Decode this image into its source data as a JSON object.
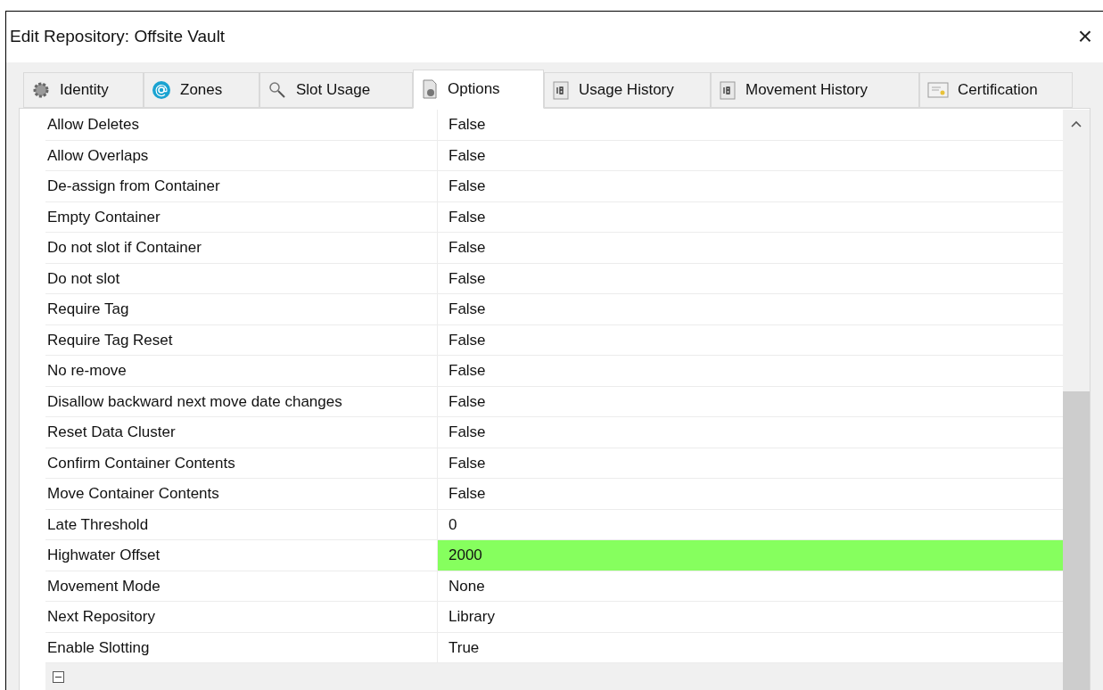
{
  "window": {
    "title": "Edit Repository: Offsite Vault",
    "close": "×"
  },
  "tabs": [
    {
      "label": "Identity",
      "kind": "gear",
      "selected": false
    },
    {
      "label": "Zones",
      "kind": "at",
      "selected": false
    },
    {
      "label": "Slot Usage",
      "kind": "search",
      "selected": false
    },
    {
      "label": "Options",
      "kind": "document",
      "selected": true
    },
    {
      "label": "Usage History",
      "kind": "calendar",
      "selected": false
    },
    {
      "label": "Movement History",
      "kind": "calendar",
      "selected": false
    },
    {
      "label": "Certification",
      "kind": "certificate",
      "selected": false
    }
  ],
  "properties": [
    {
      "name": "Allow Deletes",
      "value": "False",
      "highlighted": false
    },
    {
      "name": "Allow Overlaps",
      "value": "False",
      "highlighted": false
    },
    {
      "name": "De-assign from Container",
      "value": "False",
      "highlighted": false
    },
    {
      "name": "Empty Container",
      "value": "False",
      "highlighted": false
    },
    {
      "name": "Do not slot if Container",
      "value": "False",
      "highlighted": false
    },
    {
      "name": "Do not slot",
      "value": "False",
      "highlighted": false
    },
    {
      "name": "Require Tag",
      "value": "False",
      "highlighted": false
    },
    {
      "name": "Require Tag Reset",
      "value": "False",
      "highlighted": false
    },
    {
      "name": "No re-move",
      "value": "False",
      "highlighted": false
    },
    {
      "name": "Disallow backward next move date changes",
      "value": "False",
      "highlighted": false
    },
    {
      "name": "Reset Data Cluster",
      "value": "False",
      "highlighted": false
    },
    {
      "name": "Confirm Container Contents",
      "value": "False",
      "highlighted": false
    },
    {
      "name": "Move Container Contents",
      "value": "False",
      "highlighted": false
    },
    {
      "name": "Late Threshold",
      "value": "0",
      "highlighted": false
    },
    {
      "name": "Highwater Offset",
      "value": "2000",
      "highlighted": true
    },
    {
      "name": "Movement Mode",
      "value": "None",
      "highlighted": false
    },
    {
      "name": "Next Repository",
      "value": "Library",
      "highlighted": false
    },
    {
      "name": "Enable Slotting",
      "value": "True",
      "highlighted": false
    }
  ],
  "category": {
    "expanded": true
  }
}
